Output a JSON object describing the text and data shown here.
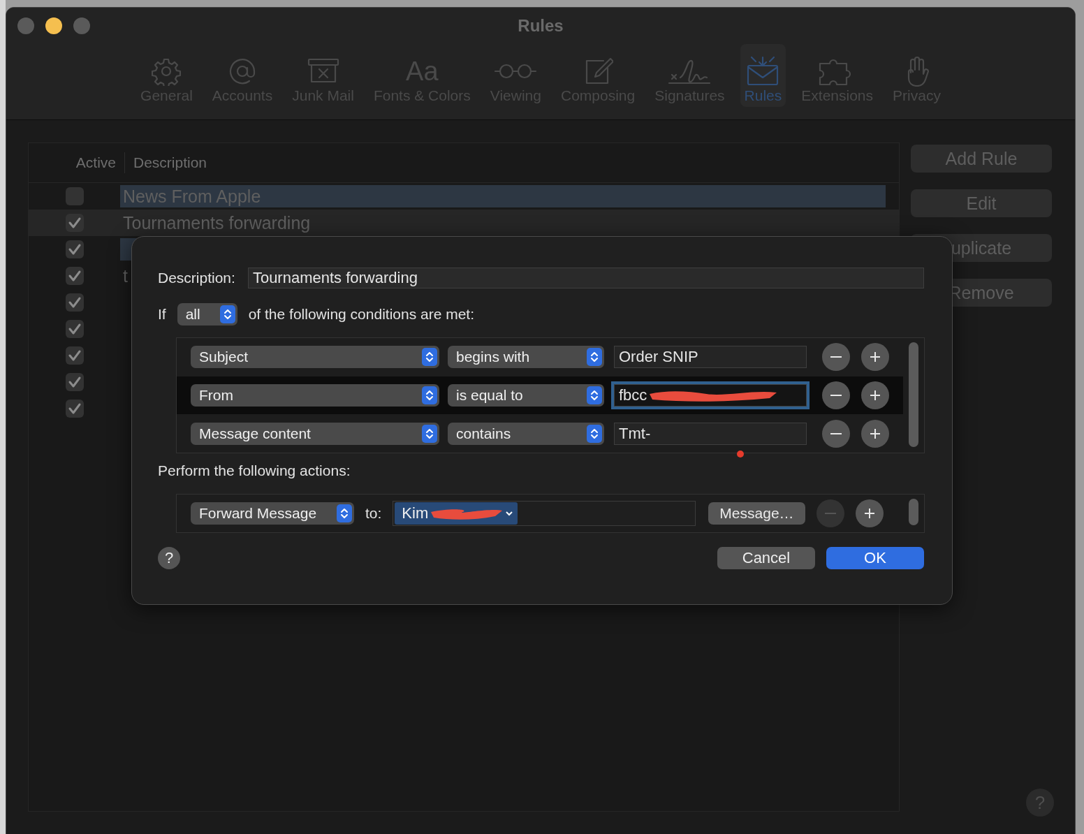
{
  "window": {
    "title": "Rules"
  },
  "tabs": [
    {
      "label": "General",
      "selected": false
    },
    {
      "label": "Accounts",
      "selected": false
    },
    {
      "label": "Junk Mail",
      "selected": false
    },
    {
      "label": "Fonts & Colors",
      "selected": false,
      "glyph": "Aa"
    },
    {
      "label": "Viewing",
      "selected": false
    },
    {
      "label": "Composing",
      "selected": false
    },
    {
      "label": "Signatures",
      "selected": false
    },
    {
      "label": "Rules",
      "selected": true
    },
    {
      "label": "Extensions",
      "selected": false
    },
    {
      "label": "Privacy",
      "selected": false
    }
  ],
  "table": {
    "columns": [
      "Active",
      "Description"
    ],
    "rows": [
      {
        "active": false,
        "description": "News From Apple",
        "selected": false,
        "highlighted": true
      },
      {
        "active": true,
        "description": "Tournaments forwarding",
        "selected": true,
        "highlighted": false
      },
      {
        "active": true,
        "selected": false,
        "highlighted": true
      },
      {
        "active": true,
        "description": "t",
        "selected": false,
        "highlighted": false
      },
      {
        "active": true,
        "selected": false,
        "highlighted": false
      },
      {
        "active": true,
        "selected": false,
        "highlighted": false
      },
      {
        "active": true,
        "selected": false,
        "highlighted": false
      },
      {
        "active": true,
        "selected": false,
        "highlighted": false
      },
      {
        "active": true,
        "selected": false,
        "highlighted": false
      }
    ]
  },
  "side_buttons": [
    "Add Rule",
    "Edit",
    "uplicate",
    "Remove"
  ],
  "sheet": {
    "description_label": "Description:",
    "description_value": "Tournaments forwarding",
    "if_label": "If",
    "match": "all",
    "conditions_text": "of the following conditions are met:",
    "conditions": [
      {
        "field": "Subject",
        "operator": "begins with",
        "value": "Order SNIP",
        "focused": false,
        "redacted": false
      },
      {
        "field": "From",
        "operator": "is equal to",
        "value": "fbcc",
        "focused": true,
        "redacted": true
      },
      {
        "field": "Message content",
        "operator": "contains",
        "value": "Tmt-",
        "focused": false,
        "redacted": false
      }
    ],
    "actions_label": "Perform the following actions:",
    "actions": [
      {
        "action": "Forward Message",
        "to_label": "to:",
        "recipient": "Kim",
        "message_button": "Message…",
        "remove_disabled": true
      }
    ],
    "help": "?",
    "cancel": "Cancel",
    "ok": "OK"
  },
  "window_help": "?"
}
